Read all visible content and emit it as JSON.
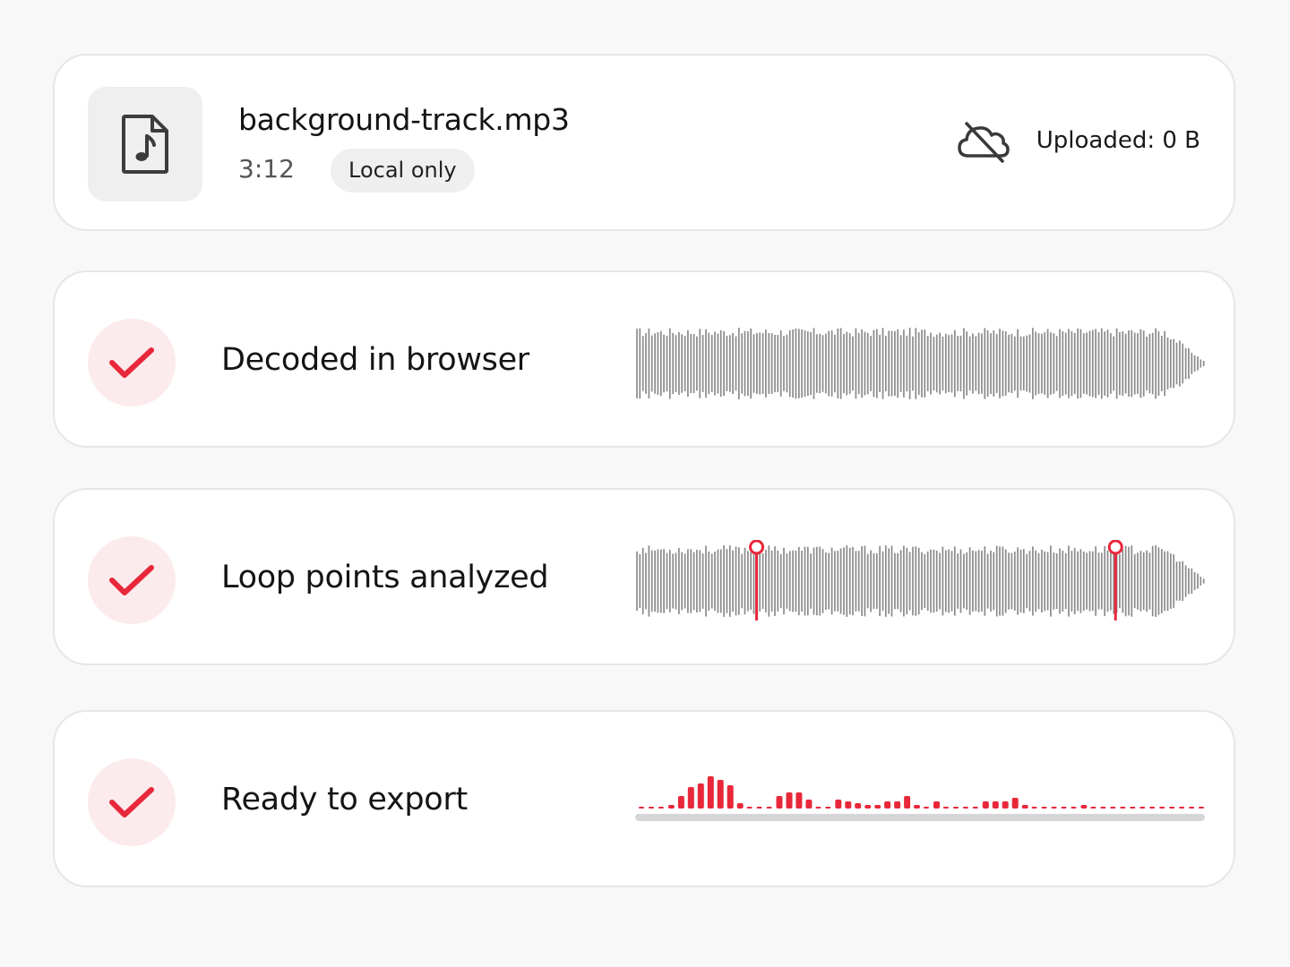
{
  "file": {
    "name": "background-track.mp3",
    "duration": "3:12",
    "badge": "Local only",
    "upload_status": "Uploaded: 0 B",
    "file_icon": "music-file-icon",
    "cloud_icon": "cloud-off-icon"
  },
  "steps": [
    {
      "label": "Decoded in browser",
      "icon": "check-icon",
      "visual": "waveform"
    },
    {
      "label": "Loop points analyzed",
      "icon": "check-icon",
      "visual": "waveform-with-loop-markers",
      "loop_markers": [
        0.21,
        0.84
      ]
    },
    {
      "label": "Ready to export",
      "icon": "check-icon",
      "visual": "spectrum-bars"
    }
  ],
  "colors": {
    "accent": "#e8283a",
    "accent_soft": "#fcebec",
    "waveform": "#8a8a8a",
    "card_border": "#e6e6e6",
    "tile_bg": "#efefef"
  }
}
